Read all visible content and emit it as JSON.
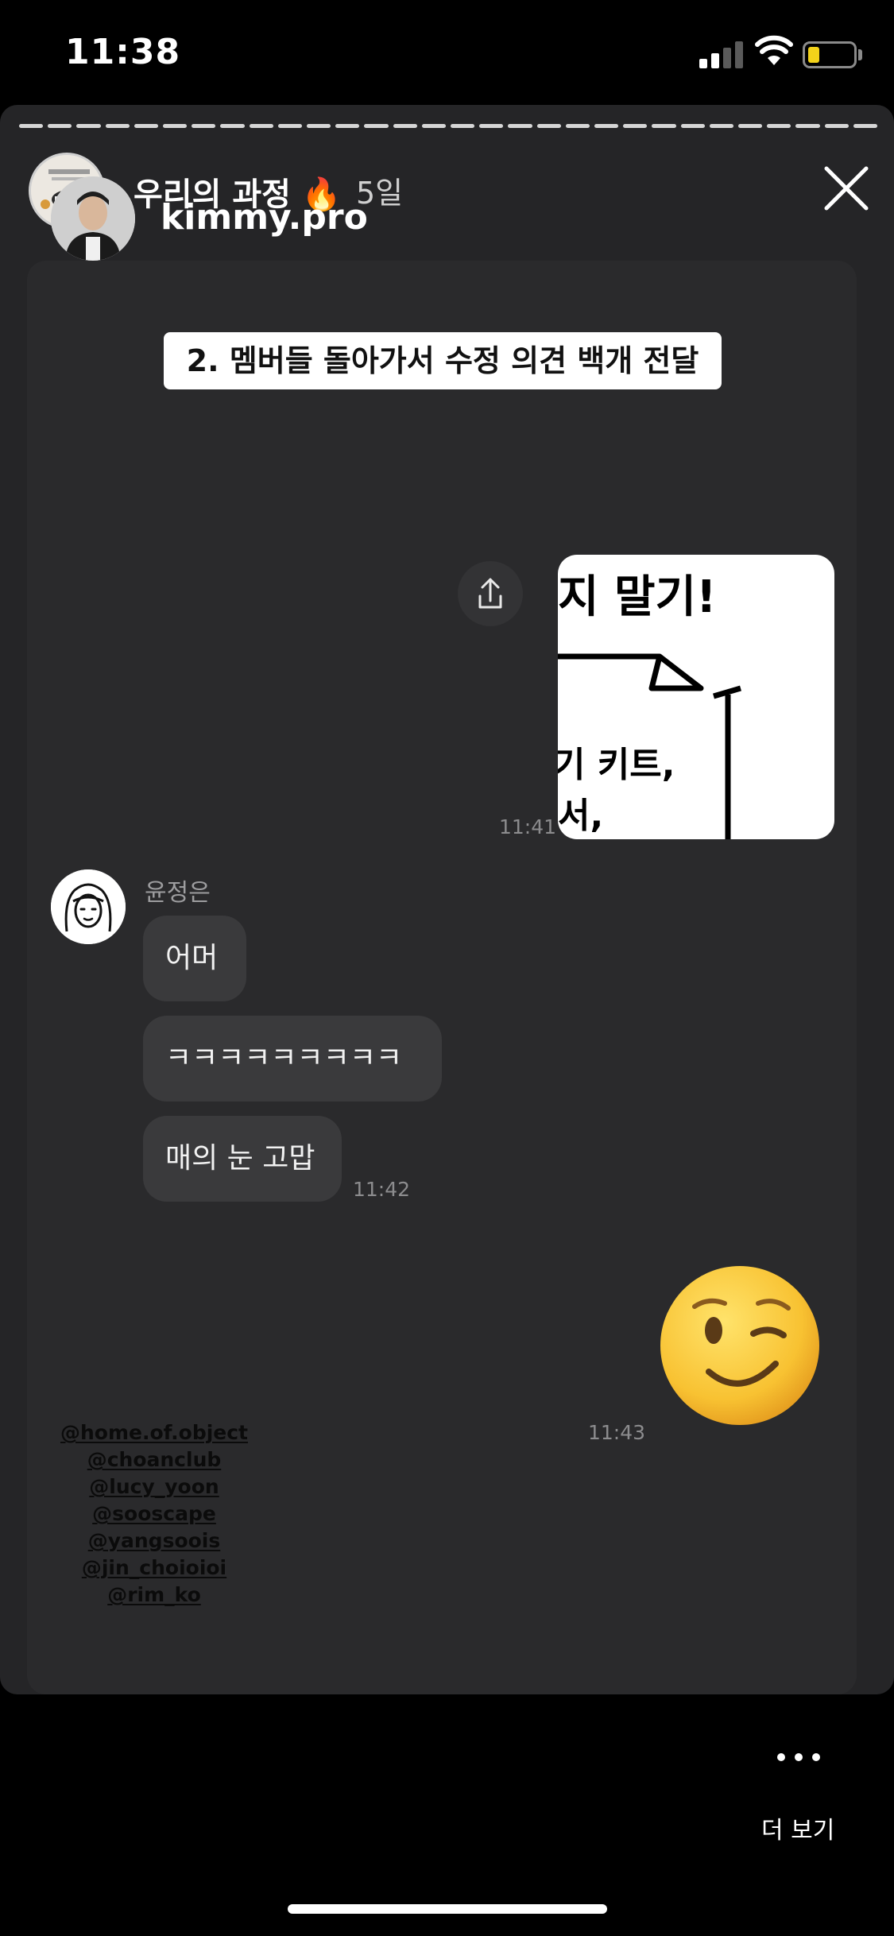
{
  "status_bar": {
    "time": "11:38"
  },
  "story": {
    "title": "우리의 과정",
    "title_emoji": "🔥",
    "age": "5일",
    "progress_segments": 30
  },
  "dm": {
    "username": "kimmy.pro",
    "caption": "2. 멤버들 돌아가서 수정 의견 백개 전달",
    "image_card": {
      "line1": "지 말기!",
      "line2": "기 키트,",
      "line3": "서,"
    },
    "time_first": "11:41",
    "sender_name": "윤정은",
    "messages": [
      "어머",
      "ㅋㅋㅋㅋㅋㅋㅋㅋㅋ",
      "매의 눈 고맙"
    ],
    "time_second": "11:42",
    "emoji": "winking-face",
    "time_third": "11:43"
  },
  "mentions": [
    "@home.of.object",
    "@choanclub",
    "@lucy_yoon",
    "@sooscape",
    "@yangsoois",
    "@jin_choioioi",
    "@rim_ko"
  ],
  "footer": {
    "more_label": "더 보기"
  },
  "colors": {
    "background": "#000000",
    "story_bg": "#252527",
    "bubble": "#3a3a3c",
    "battery_fill": "#f2d21a"
  }
}
